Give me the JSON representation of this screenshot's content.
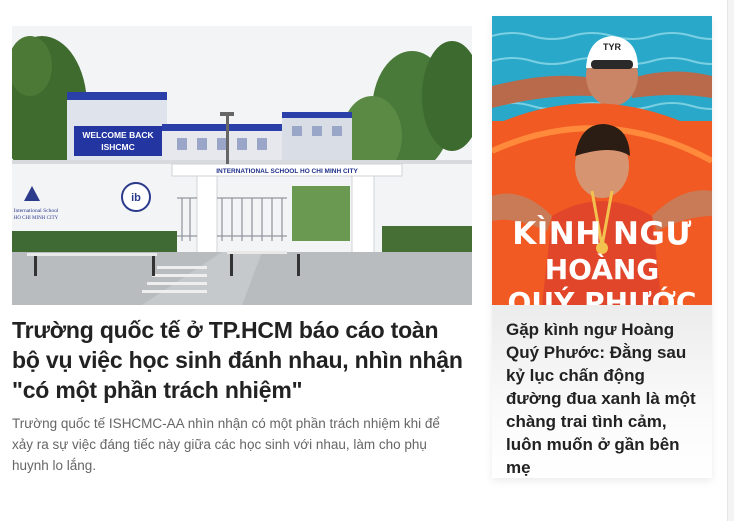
{
  "main_article": {
    "photo": {
      "banner_text_line1": "WELCOME BACK",
      "banner_text_line2": "ISHCMC",
      "gate_sign": "INTERNATIONAL SCHOOL HO CHI MINH CITY",
      "wall_logo_line1": "International School",
      "wall_logo_line2": "HO CHI MINH CITY",
      "emblem_text": "ib"
    },
    "title": "Trường quốc tế ở TP.HCM báo cáo toàn bộ vụ việc học sinh đánh nhau, nhìn nhận \"có một phần trách nhiệm\"",
    "sapo": "Trường quốc tế ISHCMC-AA nhìn nhận có một phần trách nhiệm khi để xảy ra sự việc đáng tiếc này giữa các học sinh với nhau, làm cho phụ huynh lo lắng."
  },
  "side_article": {
    "photo": {
      "cap_brand": "TYR",
      "overlay_line1": "KÌNH NGƯ",
      "overlay_line2": "HOÀNG",
      "overlay_line3": "QUÝ PHƯỚC"
    },
    "title": "Gặp kình ngư Hoàng Quý Phước: Đằng sau kỷ lục chấn động đường đua xanh là một chàng trai tình cảm, luôn muốn ở gần bên mẹ"
  },
  "colors": {
    "title_text": "#222222",
    "sapo_text": "#666666",
    "side_photo_orange": "#f15a22",
    "pool_blue": "#2aa8c9"
  }
}
